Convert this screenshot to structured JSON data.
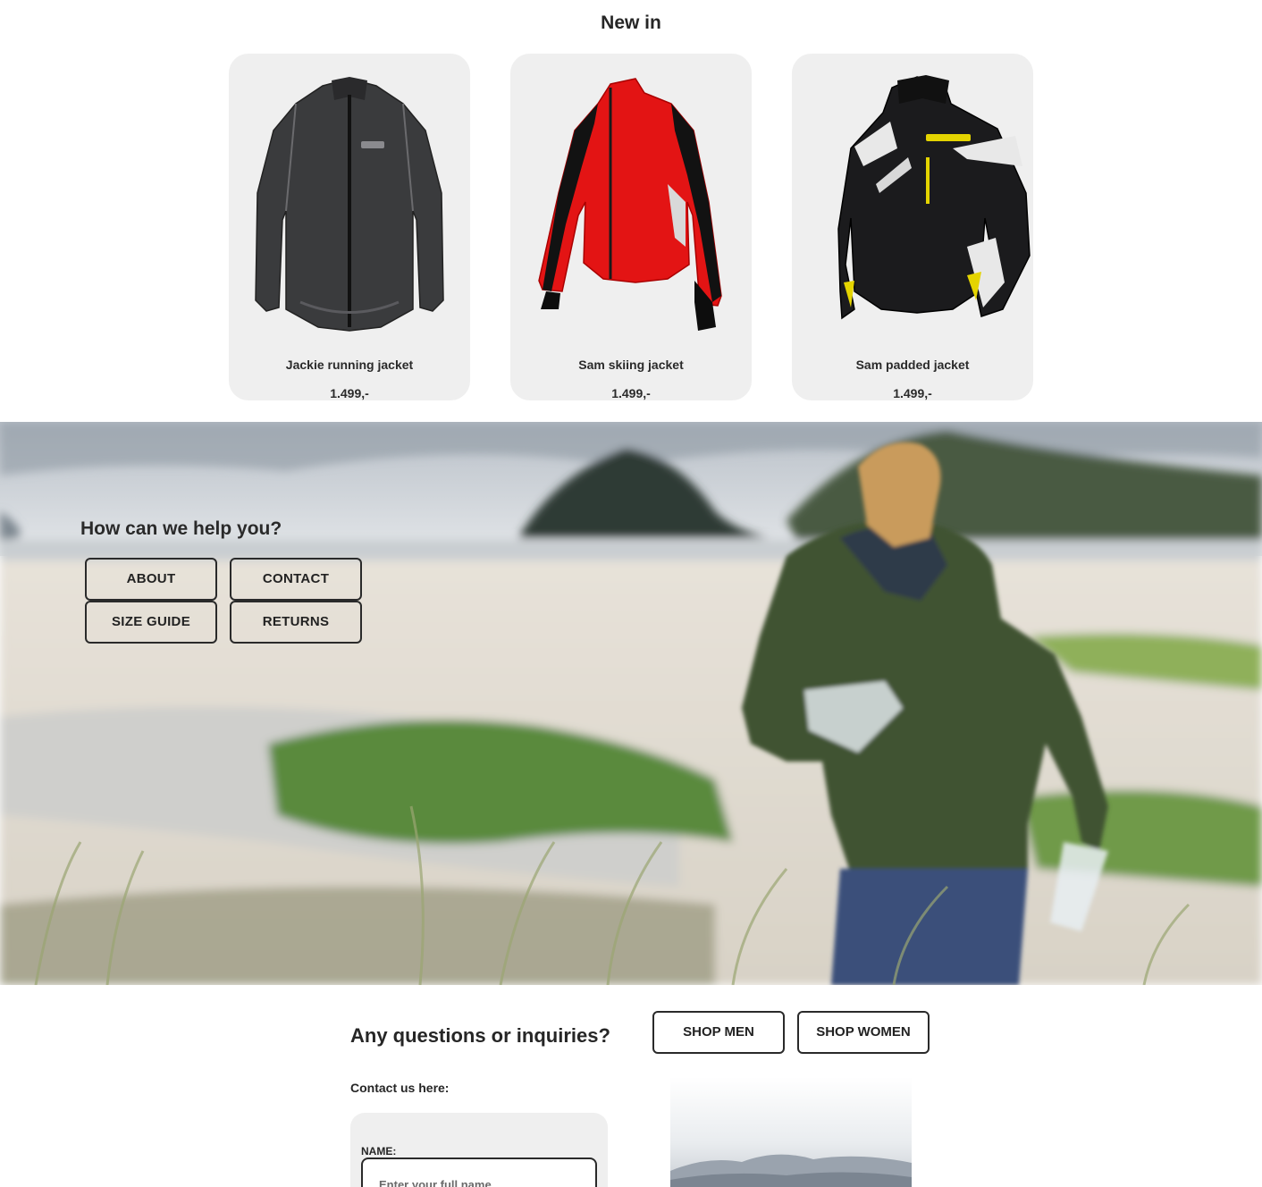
{
  "new_in": {
    "title": "New in",
    "products": [
      {
        "name": "Jackie running jacket",
        "price": "1.499,-",
        "color": "#3a3b3d"
      },
      {
        "name": "Sam skiing jacket",
        "price": "1.499,-",
        "color": "#e31414"
      },
      {
        "name": "Sam padded jacket",
        "price": "1.499,-",
        "color": "#1b1b1d"
      }
    ]
  },
  "help": {
    "title": "How can we help you?",
    "buttons": {
      "about": "ABOUT",
      "contact": "CONTACT",
      "size_guide": "SIZE GUIDE",
      "returns": "RETURNS"
    }
  },
  "inquiries": {
    "title": "Any questions or inquiries?",
    "contact_label": "Contact us here:",
    "form": {
      "name_label": "NAME:",
      "name_placeholder": "Enter your full name",
      "name_value": ""
    }
  },
  "shop": {
    "men": "SHOP MEN",
    "women": "SHOP WOMEN"
  },
  "colors": {
    "card_bg": "#efefef",
    "text": "#262626",
    "border": "#2a2a2a"
  }
}
